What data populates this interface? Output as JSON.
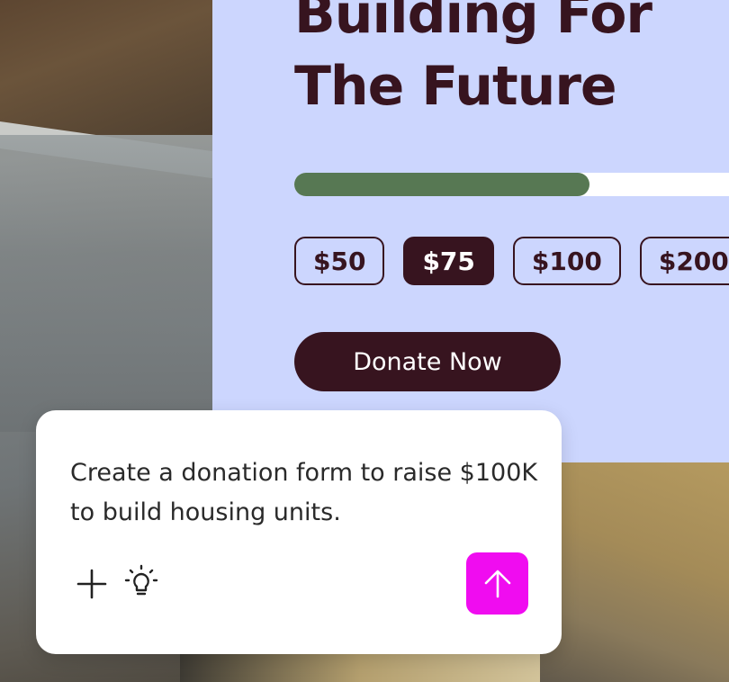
{
  "card": {
    "title": "Building For\nThe Future",
    "progress_fraction": 0.68,
    "amounts": [
      {
        "label": "$50",
        "selected": false
      },
      {
        "label": "$75",
        "selected": true
      },
      {
        "label": "$100",
        "selected": false
      },
      {
        "label": "$200",
        "selected": false
      }
    ],
    "donate_label": "Donate Now"
  },
  "prompt": {
    "text": "Create a donation form to raise $100K to build housing units.",
    "icons": [
      "plus-icon",
      "lightbulb-icon",
      "arrow-up-icon"
    ]
  },
  "colors": {
    "card_bg": "#ccd6fe",
    "dark": "#37141f",
    "progress": "#577853",
    "send_button": "#f00cf0"
  }
}
